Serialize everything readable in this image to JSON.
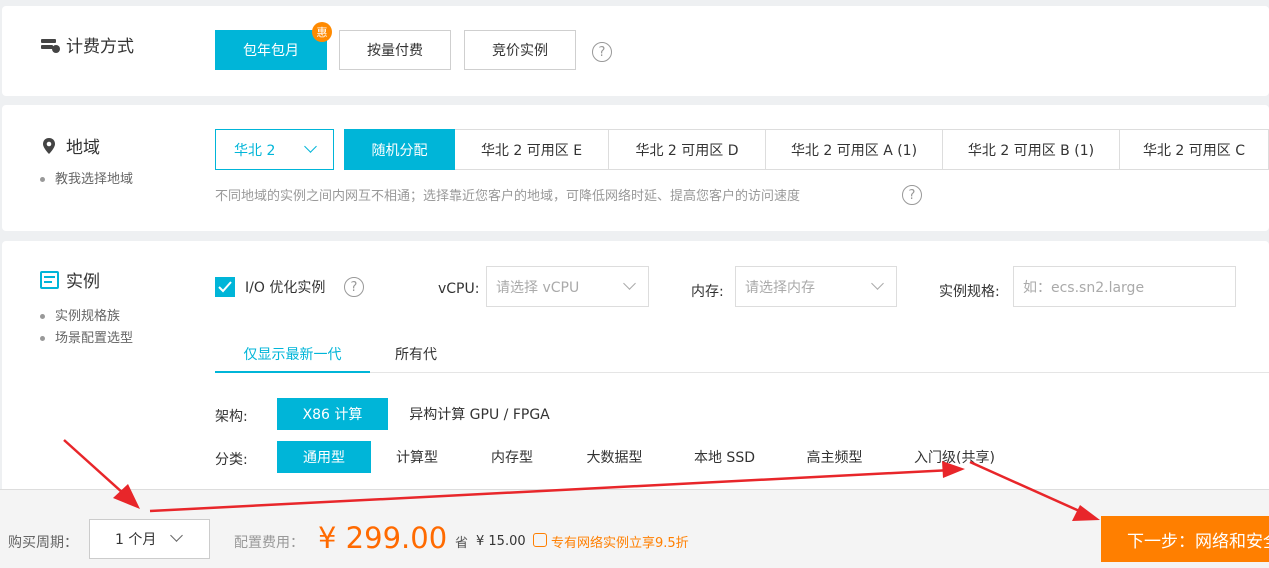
{
  "billing": {
    "title": "计费方式",
    "options": [
      "包年包月",
      "按量付费",
      "竞价实例"
    ],
    "badge": "惠",
    "help": "?"
  },
  "region": {
    "title": "地域",
    "link": "教我选择地域",
    "selected_region": "华北 2",
    "zones": [
      "随机分配",
      "华北 2 可用区 E",
      "华北 2 可用区 D",
      "华北 2 可用区 A (1)",
      "华北 2 可用区 B (1)",
      "华北 2 可用区 C"
    ],
    "hint": "不同地域的实例之间内网互不相通；选择靠近您客户的地域，可降低网络时延、提高您客户的访问速度",
    "help": "?"
  },
  "instance": {
    "title": "实例",
    "links": [
      "实例规格族",
      "场景配置选型"
    ],
    "io_optimized_label": "I/O 优化实例",
    "help": "?",
    "vcpu_label": "vCPU:",
    "vcpu_placeholder": "请选择 vCPU",
    "memory_label": "内存:",
    "memory_placeholder": "请选择内存",
    "spec_label": "实例规格:",
    "spec_placeholder": "如：ecs.sn2.large",
    "gen_tabs": [
      "仅显示最新一代",
      "所有代"
    ],
    "arch_label": "架构:",
    "arch_options": [
      "X86 计算",
      "异构计算 GPU / FPGA"
    ],
    "category_label": "分类:",
    "categories": [
      "通用型",
      "计算型",
      "内存型",
      "大数据型",
      "本地 SSD",
      "高主频型",
      "入门级(共享)"
    ]
  },
  "footer": {
    "period_label": "购买周期：",
    "period_value": "1 个月",
    "cost_label": "配置费用：",
    "price": "¥ 299.00",
    "save_prefix": "省",
    "save_amount": "¥ 15.00",
    "promo_icon": "coin-icon",
    "promo": "专有网络实例立享9.5折",
    "next_button": "下一步：网络和安全组"
  },
  "colors": {
    "accent": "#00b5d8",
    "price": "#ff6a00",
    "next": "#ff7f00",
    "arrow": "#e8262a"
  }
}
